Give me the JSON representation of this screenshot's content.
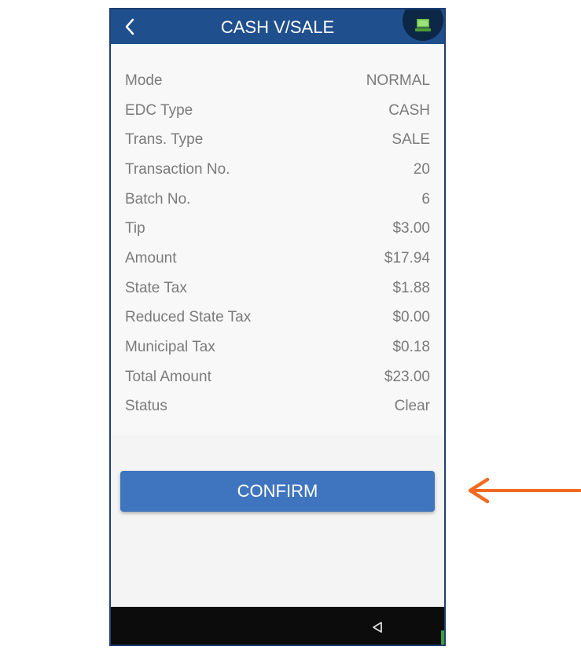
{
  "header": {
    "title": "CASH V/SALE"
  },
  "details": [
    {
      "label": "Mode",
      "value": "NORMAL"
    },
    {
      "label": "EDC Type",
      "value": "CASH"
    },
    {
      "label": "Trans. Type",
      "value": "SALE"
    },
    {
      "label": "Transaction No.",
      "value": "20"
    },
    {
      "label": "Batch No.",
      "value": "6"
    },
    {
      "label": "Tip",
      "value": "$3.00"
    },
    {
      "label": "Amount",
      "value": "$17.94"
    },
    {
      "label": "State Tax",
      "value": "$1.88"
    },
    {
      "label": "Reduced State Tax",
      "value": "$0.00"
    },
    {
      "label": "Municipal Tax",
      "value": "$0.18"
    },
    {
      "label": "Total Amount",
      "value": "$23.00"
    },
    {
      "label": "Status",
      "value": "Clear"
    }
  ],
  "confirm_label": "CONFIRM",
  "colors": {
    "header": "#204f8e",
    "button": "#3f75bf",
    "arrow": "#f26a21"
  },
  "icons": {
    "back": "chevron-left-icon",
    "station": "pos-terminal-icon",
    "nav_back": "triangle-back-icon",
    "pointer": "arrow-left-icon"
  }
}
